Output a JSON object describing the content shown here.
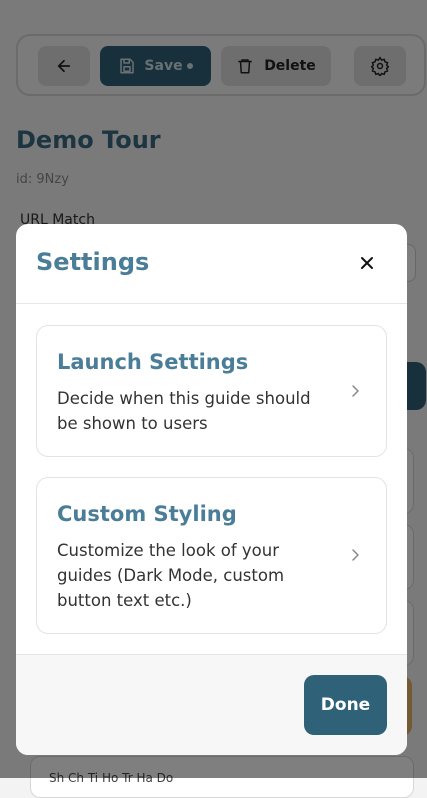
{
  "toolbar": {
    "save_label": "Save",
    "delete_label": "Delete"
  },
  "tour": {
    "title": "Demo Tour",
    "id_text": "id: 9Nzy",
    "url_match_label": "URL Match"
  },
  "background_bottom_text": "Sh  Ch   Ti  Ho  Tr  Ha  Do",
  "modal": {
    "title": "Settings",
    "options": [
      {
        "title": "Launch Settings",
        "description": "Decide when this guide should be shown to users"
      },
      {
        "title": "Custom Styling",
        "description": "Customize the look of your guides (Dark Mode, custom button text etc.)"
      }
    ],
    "done_label": "Done"
  },
  "colors": {
    "primary": "#2f6178",
    "heading": "#4a7e98",
    "accent_orange": "#e4b56a"
  }
}
